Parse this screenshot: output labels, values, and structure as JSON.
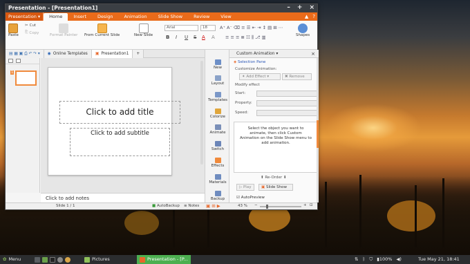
{
  "window": {
    "title": "Presentation - [Presentation1]",
    "minimize": "–",
    "maximize": "+",
    "close": "×"
  },
  "menu": {
    "app_button": "Presentation",
    "tabs": [
      "Home",
      "Insert",
      "Design",
      "Animation",
      "Slide Show",
      "Review",
      "View"
    ],
    "right_icons": [
      "▲",
      "?"
    ]
  },
  "ribbon": {
    "paste": "Paste",
    "cut": "Cut",
    "copy": "Copy",
    "format_painter": "Format Painter",
    "from_current_slide": "From Current Slide",
    "new_slide": "New Slide",
    "font": "Arial",
    "font_size": "18",
    "shapes": "Shapes",
    "format_buttons": [
      "B",
      "I",
      "U",
      "S",
      "A",
      "A"
    ]
  },
  "doc_tabs": {
    "online_templates": "Online Templates",
    "presentation": "Presentation1",
    "add": "+"
  },
  "slides_pane": {
    "slide_number": "1"
  },
  "slide": {
    "title_placeholder": "Click to add title",
    "subtitle_placeholder": "Click to add subtitle"
  },
  "notes": {
    "placeholder": "Click to add notes"
  },
  "side_strip": [
    "New",
    "Layout",
    "Templates",
    "Colorize",
    "Animate",
    "Switch",
    "Effects",
    "Backup",
    "Materials",
    "Backup"
  ],
  "animation_pane": {
    "title": "Custom Animation",
    "selection_pane": "Selection Pane",
    "customize_label": "Customize Animation:",
    "add_effect": "Add Effect",
    "remove": "Remove",
    "modify_effect": "Modify effect",
    "start": "Start:",
    "property": "Property:",
    "speed": "Speed:",
    "info": "Select the object you want to animate, then click Custom Animation on the Slide Show menu to add animation.",
    "reorder": "Re-Order",
    "play": "Play",
    "slide_show": "Slide Show",
    "autopreview": "AutoPreview"
  },
  "status_bar": {
    "slide_info": "Slide 1 / 1",
    "autobackup": "AutoBackup",
    "notes": "Notes",
    "zoom": "43 %"
  },
  "taskbar": {
    "menu": "Menu",
    "pictures": "Pictures",
    "presentation": "Presentation - [P...",
    "battery": "100%",
    "datetime": "Tue May 21, 18:41"
  }
}
